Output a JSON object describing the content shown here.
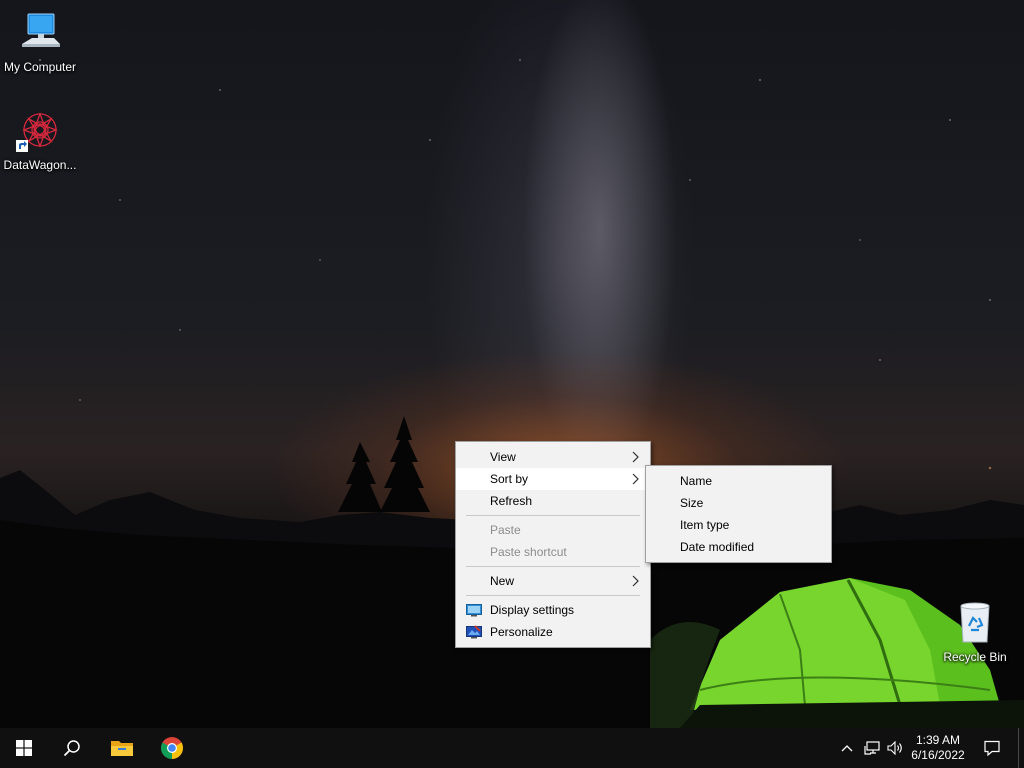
{
  "desktop": {
    "icons": [
      {
        "label": "My Computer",
        "icon": "computer-icon"
      },
      {
        "label": "DataWagon...",
        "icon": "datawagon-shortcut-icon"
      },
      {
        "label": "Recycle Bin",
        "icon": "recycle-bin-icon"
      }
    ]
  },
  "context_menu": {
    "items": {
      "view": {
        "label": "View",
        "has_submenu": true
      },
      "sort_by": {
        "label": "Sort by",
        "has_submenu": true,
        "highlighted": true
      },
      "refresh": {
        "label": "Refresh"
      },
      "paste": {
        "label": "Paste",
        "disabled": true
      },
      "paste_shortcut": {
        "label": "Paste shortcut",
        "disabled": true
      },
      "new": {
        "label": "New",
        "has_submenu": true
      },
      "display_settings": {
        "label": "Display settings",
        "icon": "display-icon"
      },
      "personalize": {
        "label": "Personalize",
        "icon": "personalize-icon"
      }
    }
  },
  "sort_submenu": {
    "items": [
      "Name",
      "Size",
      "Item type",
      "Date modified"
    ]
  },
  "taskbar": {
    "apps": [
      "windows-start-icon",
      "search-icon",
      "file-explorer-icon",
      "chrome-icon"
    ],
    "tray": [
      "chevron-up-icon",
      "network-icon",
      "volume-icon",
      "notification-icon"
    ],
    "clock": {
      "time": "1:39 AM",
      "date": "6/16/2022"
    }
  },
  "colors": {
    "menu_bg": "#f2f2f2",
    "menu_highlight": "#ffffff",
    "taskbar_bg": "#101010",
    "disabled_text": "#8c8c8c"
  }
}
